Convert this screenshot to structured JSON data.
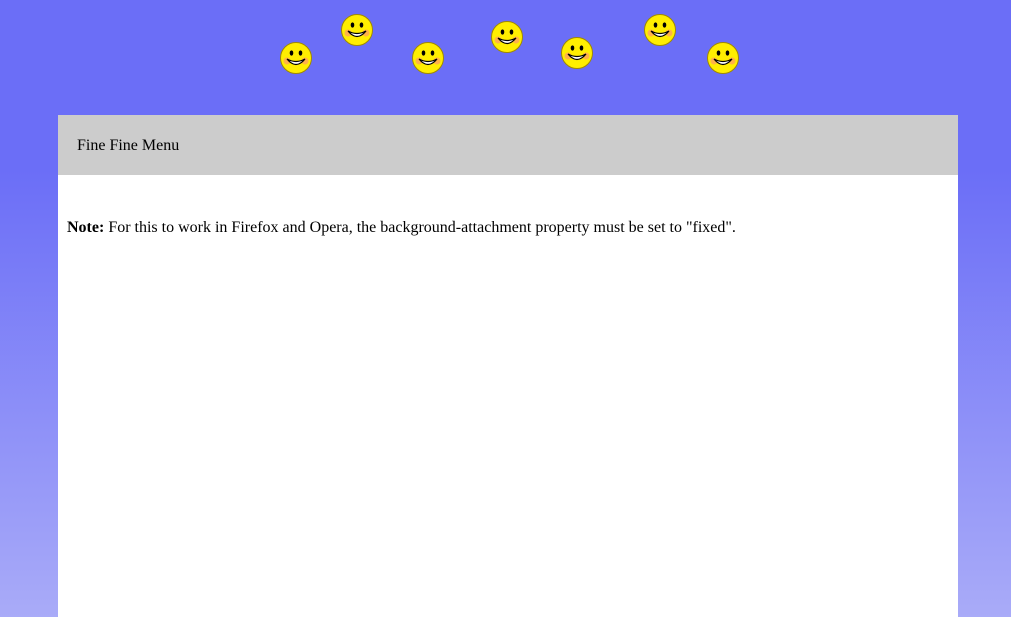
{
  "menu": {
    "label": "Fine Fine Menu"
  },
  "note": {
    "label": "Note:",
    "text": " For this to work in Firefox and Opera, the background-attachment property must be set to \"fixed\"."
  },
  "decorations": {
    "icon": "smiley-face-icon",
    "count": 7
  },
  "colors": {
    "background_top": "#6b6ef7",
    "background_bottom": "#a9abf8",
    "menu_bar": "#cccccc",
    "panel": "#ffffff",
    "smiley_fill": "#ffee00"
  }
}
